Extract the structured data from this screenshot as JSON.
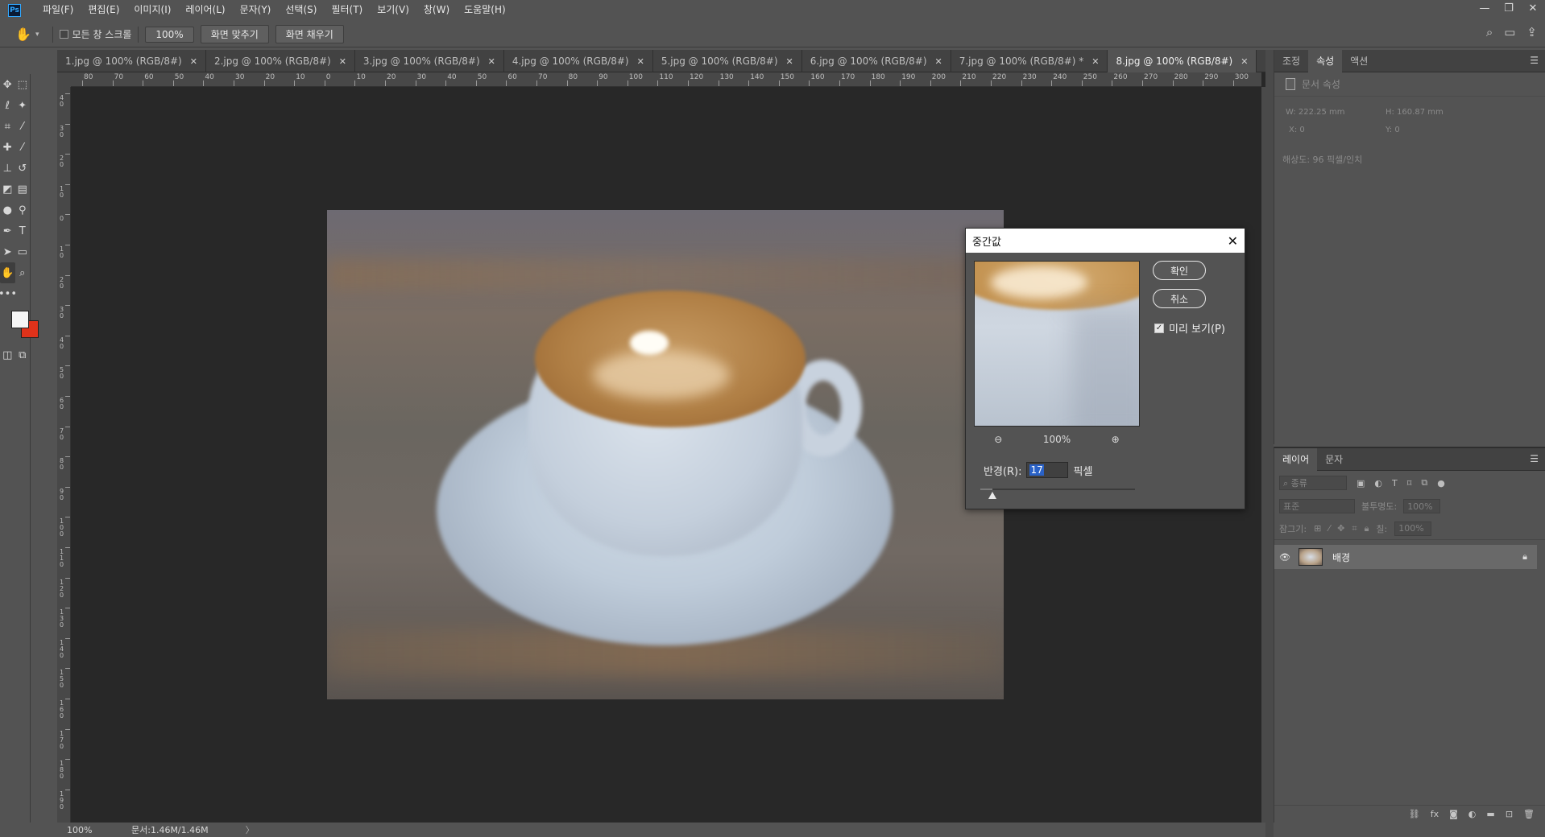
{
  "app": {
    "logo": "Ps"
  },
  "menu": [
    "파일(F)",
    "편집(E)",
    "이미지(I)",
    "레이어(L)",
    "문자(Y)",
    "선택(S)",
    "필터(T)",
    "보기(V)",
    "창(W)",
    "도움말(H)"
  ],
  "window_controls": {
    "minimize": "—",
    "restore": "❐",
    "close": "✕"
  },
  "options": {
    "scroll_all_label": "모든 창 스크롤",
    "zoom_value": "100%",
    "fit_screen_label": "화면 맞추기",
    "fill_screen_label": "화면 채우기"
  },
  "tabs": [
    {
      "label": "1.jpg @ 100% (RGB/8#)",
      "active": false
    },
    {
      "label": "2.jpg @ 100% (RGB/8#)",
      "active": false
    },
    {
      "label": "3.jpg @ 100% (RGB/8#)",
      "active": false
    },
    {
      "label": "4.jpg @ 100% (RGB/8#)",
      "active": false
    },
    {
      "label": "5.jpg @ 100% (RGB/8#)",
      "active": false
    },
    {
      "label": "6.jpg @ 100% (RGB/8#)",
      "active": false
    },
    {
      "label": "7.jpg @ 100% (RGB/8#) *",
      "active": false
    },
    {
      "label": "8.jpg @ 100% (RGB/8#)",
      "active": true
    }
  ],
  "ruler": {
    "h_labels": [
      "80",
      "70",
      "60",
      "50",
      "40",
      "30",
      "20",
      "10",
      "0",
      "10",
      "20",
      "30",
      "40",
      "50",
      "60",
      "70",
      "80",
      "90",
      "100",
      "110",
      "120",
      "130",
      "140",
      "150",
      "160",
      "170",
      "180",
      "190",
      "200",
      "210",
      "220",
      "230",
      "240",
      "250",
      "260",
      "270",
      "280",
      "290",
      "300"
    ],
    "v_labels": [
      "40",
      "30",
      "20",
      "10",
      "0",
      "10",
      "20",
      "30",
      "40",
      "50",
      "60",
      "70",
      "80",
      "90",
      "100",
      "110",
      "120",
      "130",
      "140",
      "150",
      "160",
      "170",
      "180",
      "190"
    ]
  },
  "dialog": {
    "title": "중간값",
    "ok_label": "확인",
    "cancel_label": "취소",
    "preview_label": "미리 보기(P)",
    "preview_checked": true,
    "zoom_out": "⊖",
    "zoom_level": "100%",
    "zoom_in": "⊕",
    "radius_label": "반경(R):",
    "radius_value": "17",
    "radius_unit": "픽셀",
    "radius_slider_fraction": 0.08
  },
  "status": {
    "zoom": "100%",
    "doc_size": "문서:1.46M/1.46M",
    "arrow": "〉"
  },
  "properties_panel": {
    "tabs": [
      "조정",
      "속성",
      "액션"
    ],
    "active_tab": "속성",
    "header": "문서 속성",
    "w": "W:  222.25 mm",
    "h": "H:  160.87 mm",
    "x": "X:  0",
    "y": "Y:  0",
    "resolution": "해상도: 96 픽셀/인치"
  },
  "layers_panel": {
    "tabs": [
      "레이어",
      "문자"
    ],
    "active_tab": "레이어",
    "kind_placeholder": "⌕ 종류",
    "blend_mode": "표준",
    "opacity_label": "불투명도:",
    "opacity_value": "100%",
    "lock_label": "잠그기:",
    "fill_label": "칠:",
    "fill_value": "100%",
    "layers": [
      {
        "name": "배경",
        "visible": true,
        "locked": true
      }
    ]
  },
  "colors": {
    "foreground": "#f6f6f6",
    "background": "#e0321a",
    "ui_base": "#535353",
    "canvas_area": "#282828",
    "selection_highlight": "#2a62c7"
  },
  "icons": {
    "toolbar": [
      "move-icon",
      "marquee-icon",
      "lasso-icon",
      "magic-wand-icon",
      "crop-icon",
      "eyedropper-icon",
      "healing-brush-icon",
      "brush-icon",
      "clone-stamp-icon",
      "history-brush-icon",
      "eraser-icon",
      "gradient-icon",
      "blur-icon",
      "dodge-icon",
      "pen-icon",
      "type-icon",
      "path-selection-icon",
      "rectangle-icon",
      "hand-icon",
      "zoom-icon",
      "more-tools-icon"
    ]
  }
}
